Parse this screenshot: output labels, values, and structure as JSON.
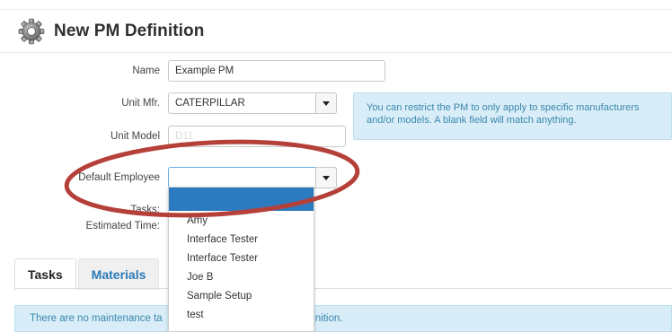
{
  "page": {
    "title": "New PM Definition"
  },
  "form": {
    "name": {
      "label": "Name",
      "value": "Example PM"
    },
    "unit_mfr": {
      "label": "Unit Mfr.",
      "value": "CATERPILLAR"
    },
    "unit_model": {
      "label": "Unit Model",
      "value": "D11"
    },
    "default_employee": {
      "label": "Default Employee",
      "value": ""
    },
    "tasks": {
      "label": "Tasks:"
    },
    "estimated_time": {
      "label": "Estimated Time:"
    }
  },
  "info_box": {
    "text": "You can restrict the PM to only apply to specific manufacturers and/or models. A blank field will match anything."
  },
  "employee_dropdown": {
    "options": [
      "",
      "Amy",
      "Interface Tester",
      "Interface Tester",
      "Joe B",
      "Sample Setup",
      "test"
    ]
  },
  "tabs": [
    {
      "label": "Tasks",
      "active": true
    },
    {
      "label": "Materials",
      "active": false
    }
  ],
  "alert": {
    "text_left": "There are no maintenance ta",
    "text_right": "finition."
  },
  "colors": {
    "info_bg": "#d8edf7",
    "info_text": "#3a87ad",
    "selected_option": "#2c7ac0",
    "annotation_ellipse": "#b5403a",
    "tab_link": "#2a7ab8"
  }
}
